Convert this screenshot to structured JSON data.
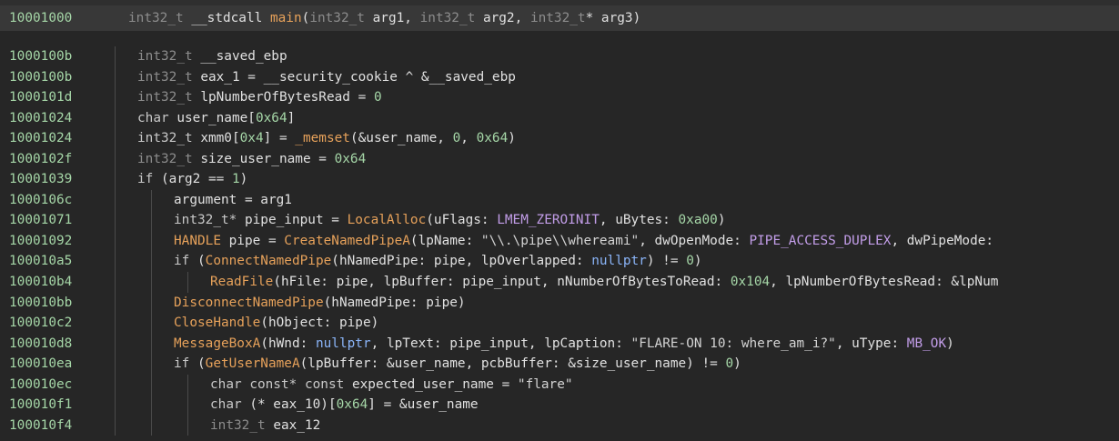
{
  "header": {
    "address": "10001000",
    "signature": [
      [
        "t-type",
        "int32_t"
      ],
      [
        "t-op",
        " "
      ],
      [
        "t-name",
        "__stdcall"
      ],
      [
        "t-op",
        " "
      ],
      [
        "t-fn",
        "main"
      ],
      [
        "t-op",
        "("
      ],
      [
        "t-type",
        "int32_t"
      ],
      [
        "t-op",
        " arg1, "
      ],
      [
        "t-type",
        "int32_t"
      ],
      [
        "t-op",
        " arg2, "
      ],
      [
        "t-type",
        "int32_t"
      ],
      [
        "t-op",
        "* arg3)"
      ]
    ]
  },
  "lines": [
    {
      "addr": "1000100b",
      "indent": 0,
      "tokens": [
        [
          "t-type",
          "int32_t"
        ],
        [
          "t-op",
          " __saved_ebp"
        ]
      ]
    },
    {
      "addr": "1000100b",
      "indent": 0,
      "tokens": [
        [
          "t-type",
          "int32_t"
        ],
        [
          "t-op",
          " eax_1 = "
        ],
        [
          "t-name",
          "__security_cookie"
        ],
        [
          "t-op",
          " ^ &__saved_ebp"
        ]
      ]
    },
    {
      "addr": "1000101d",
      "indent": 0,
      "tokens": [
        [
          "t-type",
          "int32_t"
        ],
        [
          "t-op",
          " lpNumberOfBytesRead = "
        ],
        [
          "t-num",
          "0"
        ]
      ]
    },
    {
      "addr": "10001024",
      "indent": 0,
      "tokens": [
        [
          "t-kw",
          "char"
        ],
        [
          "t-op",
          " user_name["
        ],
        [
          "t-num",
          "0x64"
        ],
        [
          "t-op",
          "]"
        ]
      ]
    },
    {
      "addr": "10001024",
      "indent": 0,
      "tokens": [
        [
          "t-kw",
          "int32_t"
        ],
        [
          "t-op",
          " xmm0["
        ],
        [
          "t-num",
          "0x4"
        ],
        [
          "t-op",
          "] = "
        ],
        [
          "t-fn",
          "_memset"
        ],
        [
          "t-op",
          "(&user_name, "
        ],
        [
          "t-num",
          "0"
        ],
        [
          "t-op",
          ", "
        ],
        [
          "t-num",
          "0x64"
        ],
        [
          "t-op",
          ")"
        ]
      ]
    },
    {
      "addr": "1000102f",
      "indent": 0,
      "tokens": [
        [
          "t-type",
          "int32_t"
        ],
        [
          "t-op",
          " size_user_name = "
        ],
        [
          "t-num",
          "0x64"
        ]
      ]
    },
    {
      "addr": "10001039",
      "indent": 0,
      "tokens": [
        [
          "t-kw",
          "if"
        ],
        [
          "t-op",
          " (arg2 == "
        ],
        [
          "t-num",
          "1"
        ],
        [
          "t-op",
          ")"
        ]
      ]
    },
    {
      "addr": "1000106c",
      "indent": 1,
      "tokens": [
        [
          "t-op",
          "argument = arg1"
        ]
      ]
    },
    {
      "addr": "10001071",
      "indent": 1,
      "tokens": [
        [
          "t-kw",
          "int32_t*"
        ],
        [
          "t-op",
          " pipe_input = "
        ],
        [
          "t-fn",
          "LocalAlloc"
        ],
        [
          "t-op",
          "(uFlags: "
        ],
        [
          "t-const",
          "LMEM_ZEROINIT"
        ],
        [
          "t-op",
          ", uBytes: "
        ],
        [
          "t-num",
          "0xa00"
        ],
        [
          "t-op",
          ")"
        ]
      ]
    },
    {
      "addr": "10001092",
      "indent": 1,
      "tokens": [
        [
          "t-fn",
          "HANDLE"
        ],
        [
          "t-op",
          " pipe = "
        ],
        [
          "t-fn",
          "CreateNamedPipeA"
        ],
        [
          "t-op",
          "(lpName: "
        ],
        [
          "t-str",
          "\"\\\\.\\pipe\\\\whereami\""
        ],
        [
          "t-op",
          ", dwOpenMode: "
        ],
        [
          "t-const",
          "PIPE_ACCESS_DUPLEX"
        ],
        [
          "t-op",
          ", dwPipeMode: "
        ]
      ]
    },
    {
      "addr": "100010a5",
      "indent": 1,
      "tokens": [
        [
          "t-kw",
          "if"
        ],
        [
          "t-op",
          " ("
        ],
        [
          "t-fn",
          "ConnectNamedPipe"
        ],
        [
          "t-op",
          "(hNamedPipe: pipe, lpOverlapped: "
        ],
        [
          "t-null",
          "nullptr"
        ],
        [
          "t-op",
          ") != "
        ],
        [
          "t-num",
          "0"
        ],
        [
          "t-op",
          ")"
        ]
      ]
    },
    {
      "addr": "100010b4",
      "indent": 2,
      "tokens": [
        [
          "t-fn",
          "ReadFile"
        ],
        [
          "t-op",
          "(hFile: pipe, lpBuffer: pipe_input, nNumberOfBytesToRead: "
        ],
        [
          "t-num",
          "0x104"
        ],
        [
          "t-op",
          ", lpNumberOfBytesRead: &lpNum"
        ]
      ]
    },
    {
      "addr": "100010bb",
      "indent": 1,
      "tokens": [
        [
          "t-fn",
          "DisconnectNamedPipe"
        ],
        [
          "t-op",
          "(hNamedPipe: pipe)"
        ]
      ]
    },
    {
      "addr": "100010c2",
      "indent": 1,
      "tokens": [
        [
          "t-fn",
          "CloseHandle"
        ],
        [
          "t-op",
          "(hObject: pipe)"
        ]
      ]
    },
    {
      "addr": "100010d8",
      "indent": 1,
      "tokens": [
        [
          "t-fn",
          "MessageBoxA"
        ],
        [
          "t-op",
          "(hWnd: "
        ],
        [
          "t-null",
          "nullptr"
        ],
        [
          "t-op",
          ", lpText: pipe_input, lpCaption: "
        ],
        [
          "t-str",
          "\"FLARE-ON 10: where_am_i?\""
        ],
        [
          "t-op",
          ", uType: "
        ],
        [
          "t-const",
          "MB_OK"
        ],
        [
          "t-op",
          ")"
        ]
      ]
    },
    {
      "addr": "100010ea",
      "indent": 1,
      "tokens": [
        [
          "t-kw",
          "if"
        ],
        [
          "t-op",
          " ("
        ],
        [
          "t-fn",
          "GetUserNameA"
        ],
        [
          "t-op",
          "(lpBuffer: &user_name, pcbBuffer: &size_user_name) != "
        ],
        [
          "t-num",
          "0"
        ],
        [
          "t-op",
          ")"
        ]
      ]
    },
    {
      "addr": "100010ec",
      "indent": 2,
      "tokens": [
        [
          "t-kw",
          "char const* const"
        ],
        [
          "t-op",
          " expected_user_name = "
        ],
        [
          "t-str",
          "\"flare\""
        ]
      ]
    },
    {
      "addr": "100010f1",
      "indent": 2,
      "tokens": [
        [
          "t-kw",
          "char"
        ],
        [
          "t-op",
          " (* eax_10)["
        ],
        [
          "t-num",
          "0x64"
        ],
        [
          "t-op",
          "] = &user_name"
        ]
      ]
    },
    {
      "addr": "100010f4",
      "indent": 2,
      "tokens": [
        [
          "t-type",
          "int32_t"
        ],
        [
          "t-op",
          " eax_12"
        ]
      ]
    }
  ]
}
